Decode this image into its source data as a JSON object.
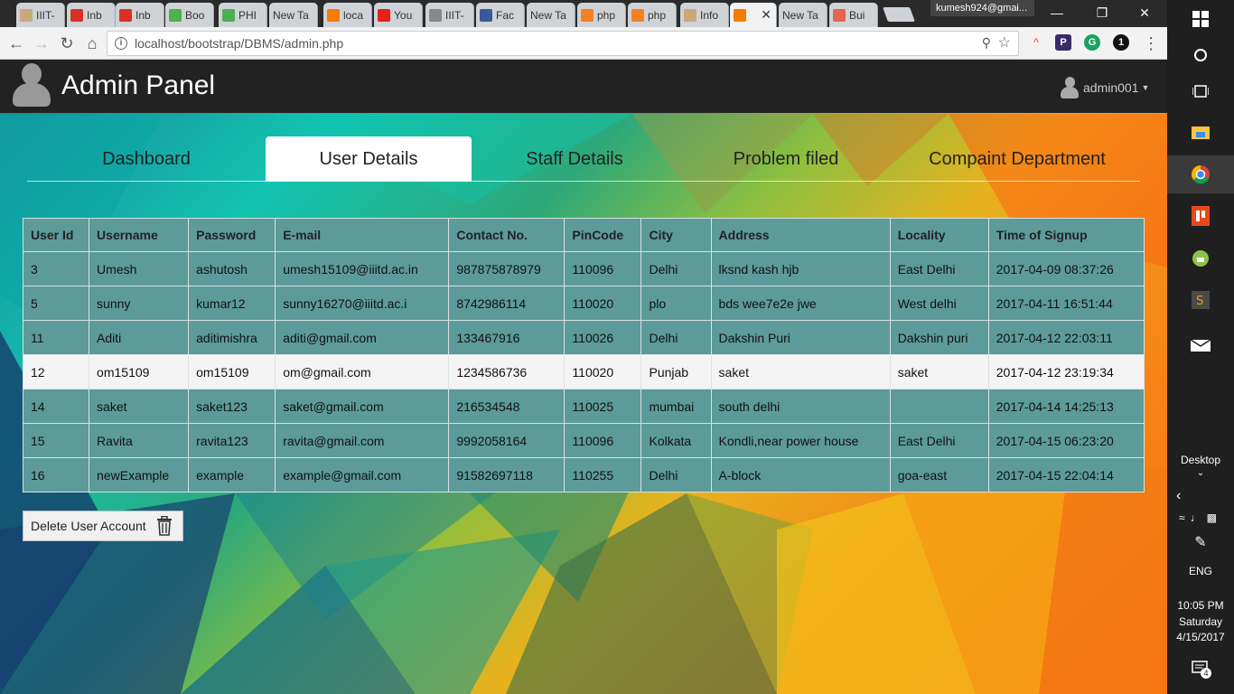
{
  "browser": {
    "tabs": [
      {
        "label": "IIIT-",
        "color": "#c9a87a"
      },
      {
        "label": "Inb",
        "color": "#d93025"
      },
      {
        "label": "Inb",
        "color": "#d93025"
      },
      {
        "label": "Boo",
        "color": "#4caf50"
      },
      {
        "label": "PHI",
        "color": "#4caf50"
      },
      {
        "label": "New Ta",
        "color": ""
      },
      {
        "label": "loca",
        "color": "#f57c00"
      },
      {
        "label": "You",
        "color": "#e62117"
      },
      {
        "label": "IIIT-",
        "color": "#888888"
      },
      {
        "label": "Fac",
        "color": "#3b5998"
      },
      {
        "label": "New Ta",
        "color": ""
      },
      {
        "label": "php",
        "color": "#f48024"
      },
      {
        "label": "php",
        "color": "#f48024"
      },
      {
        "label": "Info",
        "color": "#c9a87a"
      },
      {
        "label": "",
        "color": "#f57c00",
        "active": true
      },
      {
        "label": "New Ta",
        "color": ""
      },
      {
        "label": "Bui",
        "color": "#e2674a"
      }
    ],
    "profile_name": "kumesh924@gmai...",
    "url": "localhost/bootstrap/DBMS/admin.php",
    "info_icon": "info-icon",
    "extensions": [
      "P",
      "G",
      "1"
    ]
  },
  "app": {
    "title": "Admin Panel",
    "user": "admin001",
    "nav_tabs": [
      "Dashboard",
      "User Details",
      "Staff Details",
      "Problem filed",
      "Compaint Department"
    ],
    "active_tab": "User Details"
  },
  "table": {
    "headers": [
      "User Id",
      "Username",
      "Password",
      "E-mail",
      "Contact No.",
      "PinCode",
      "City",
      "Address",
      "Locality",
      "Time of Signup"
    ],
    "rows": [
      [
        "3",
        "Umesh",
        "ashutosh",
        "umesh15109@iiitd.ac.in",
        "987875878979",
        "110096",
        "Delhi",
        "lksnd kash hjb",
        "East Delhi",
        "2017-04-09 08:37:26"
      ],
      [
        "5",
        "sunny",
        "kumar12",
        "sunny16270@iiitd.ac.i",
        "8742986114",
        "110020",
        "plo",
        "bds wee7e2e jwe",
        "West delhi",
        "2017-04-11 16:51:44"
      ],
      [
        "11",
        "Aditi",
        "aditimishra",
        "aditi@gmail.com",
        "133467916",
        "110026",
        "Delhi",
        "Dakshin Puri",
        "Dakshin puri",
        "2017-04-12 22:03:11"
      ],
      [
        "12",
        "om15109",
        "om15109",
        "om@gmail.com",
        "1234586736",
        "110020",
        "Punjab",
        "saket",
        "saket",
        "2017-04-12 23:19:34"
      ],
      [
        "14",
        "saket",
        "saket123",
        "saket@gmail.com",
        "216534548",
        "110025",
        "mumbai",
        "south delhi",
        "",
        "2017-04-14 14:25:13"
      ],
      [
        "15",
        "Ravita",
        "ravita123",
        "ravita@gmail.com",
        "9992058164",
        "110096",
        "Kolkata",
        "Kondli,near power house",
        "East Delhi",
        "2017-04-15 06:23:20"
      ],
      [
        "16",
        "newExample",
        "example",
        "example@gmail.com",
        "91582697118",
        "110255",
        "Delhi",
        "A-block",
        "goa-east",
        "2017-04-15 22:04:14"
      ]
    ],
    "highlighted_row": 3
  },
  "actions": {
    "delete_label": "Delete User Account"
  },
  "taskbar": {
    "desktop_label": "Desktop",
    "language": "ENG",
    "time": "10:05 PM",
    "day": "Saturday",
    "date": "4/15/2017",
    "notifications": "4"
  }
}
